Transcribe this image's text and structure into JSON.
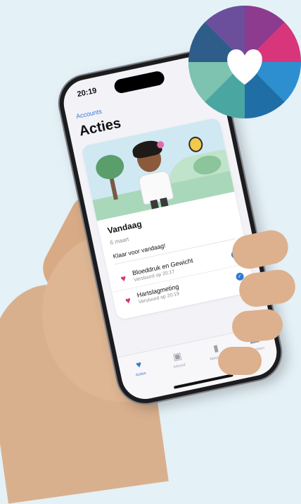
{
  "status": {
    "time": "20:19"
  },
  "nav": {
    "back_label": "Accounts"
  },
  "page": {
    "title": "Acties"
  },
  "today": {
    "title": "Vandaag",
    "date": "6 maart",
    "message": "Klaar voor vandaag!"
  },
  "tasks": [
    {
      "name": "Bloeddruk en Gewicht",
      "sub": "Verstuurd op 20:17",
      "icon": "heart-scale-icon",
      "done": true
    },
    {
      "name": "Hartslagmeting",
      "sub": "Verstuurd op 20:19",
      "icon": "heart-pulse-icon",
      "done": true
    }
  ],
  "tabs": [
    {
      "label": "Acties",
      "icon": "heart-icon",
      "active": true
    },
    {
      "label": "Inhoud",
      "icon": "document-icon",
      "active": false
    },
    {
      "label": "Metingen",
      "icon": "chart-icon",
      "active": false
    },
    {
      "label": "Berichten",
      "icon": "chat-icon",
      "active": false,
      "badge": "1"
    }
  ],
  "colors": {
    "accent": "#2f7ad6",
    "heart": "#d6337a",
    "badge": "#e64a3b"
  }
}
